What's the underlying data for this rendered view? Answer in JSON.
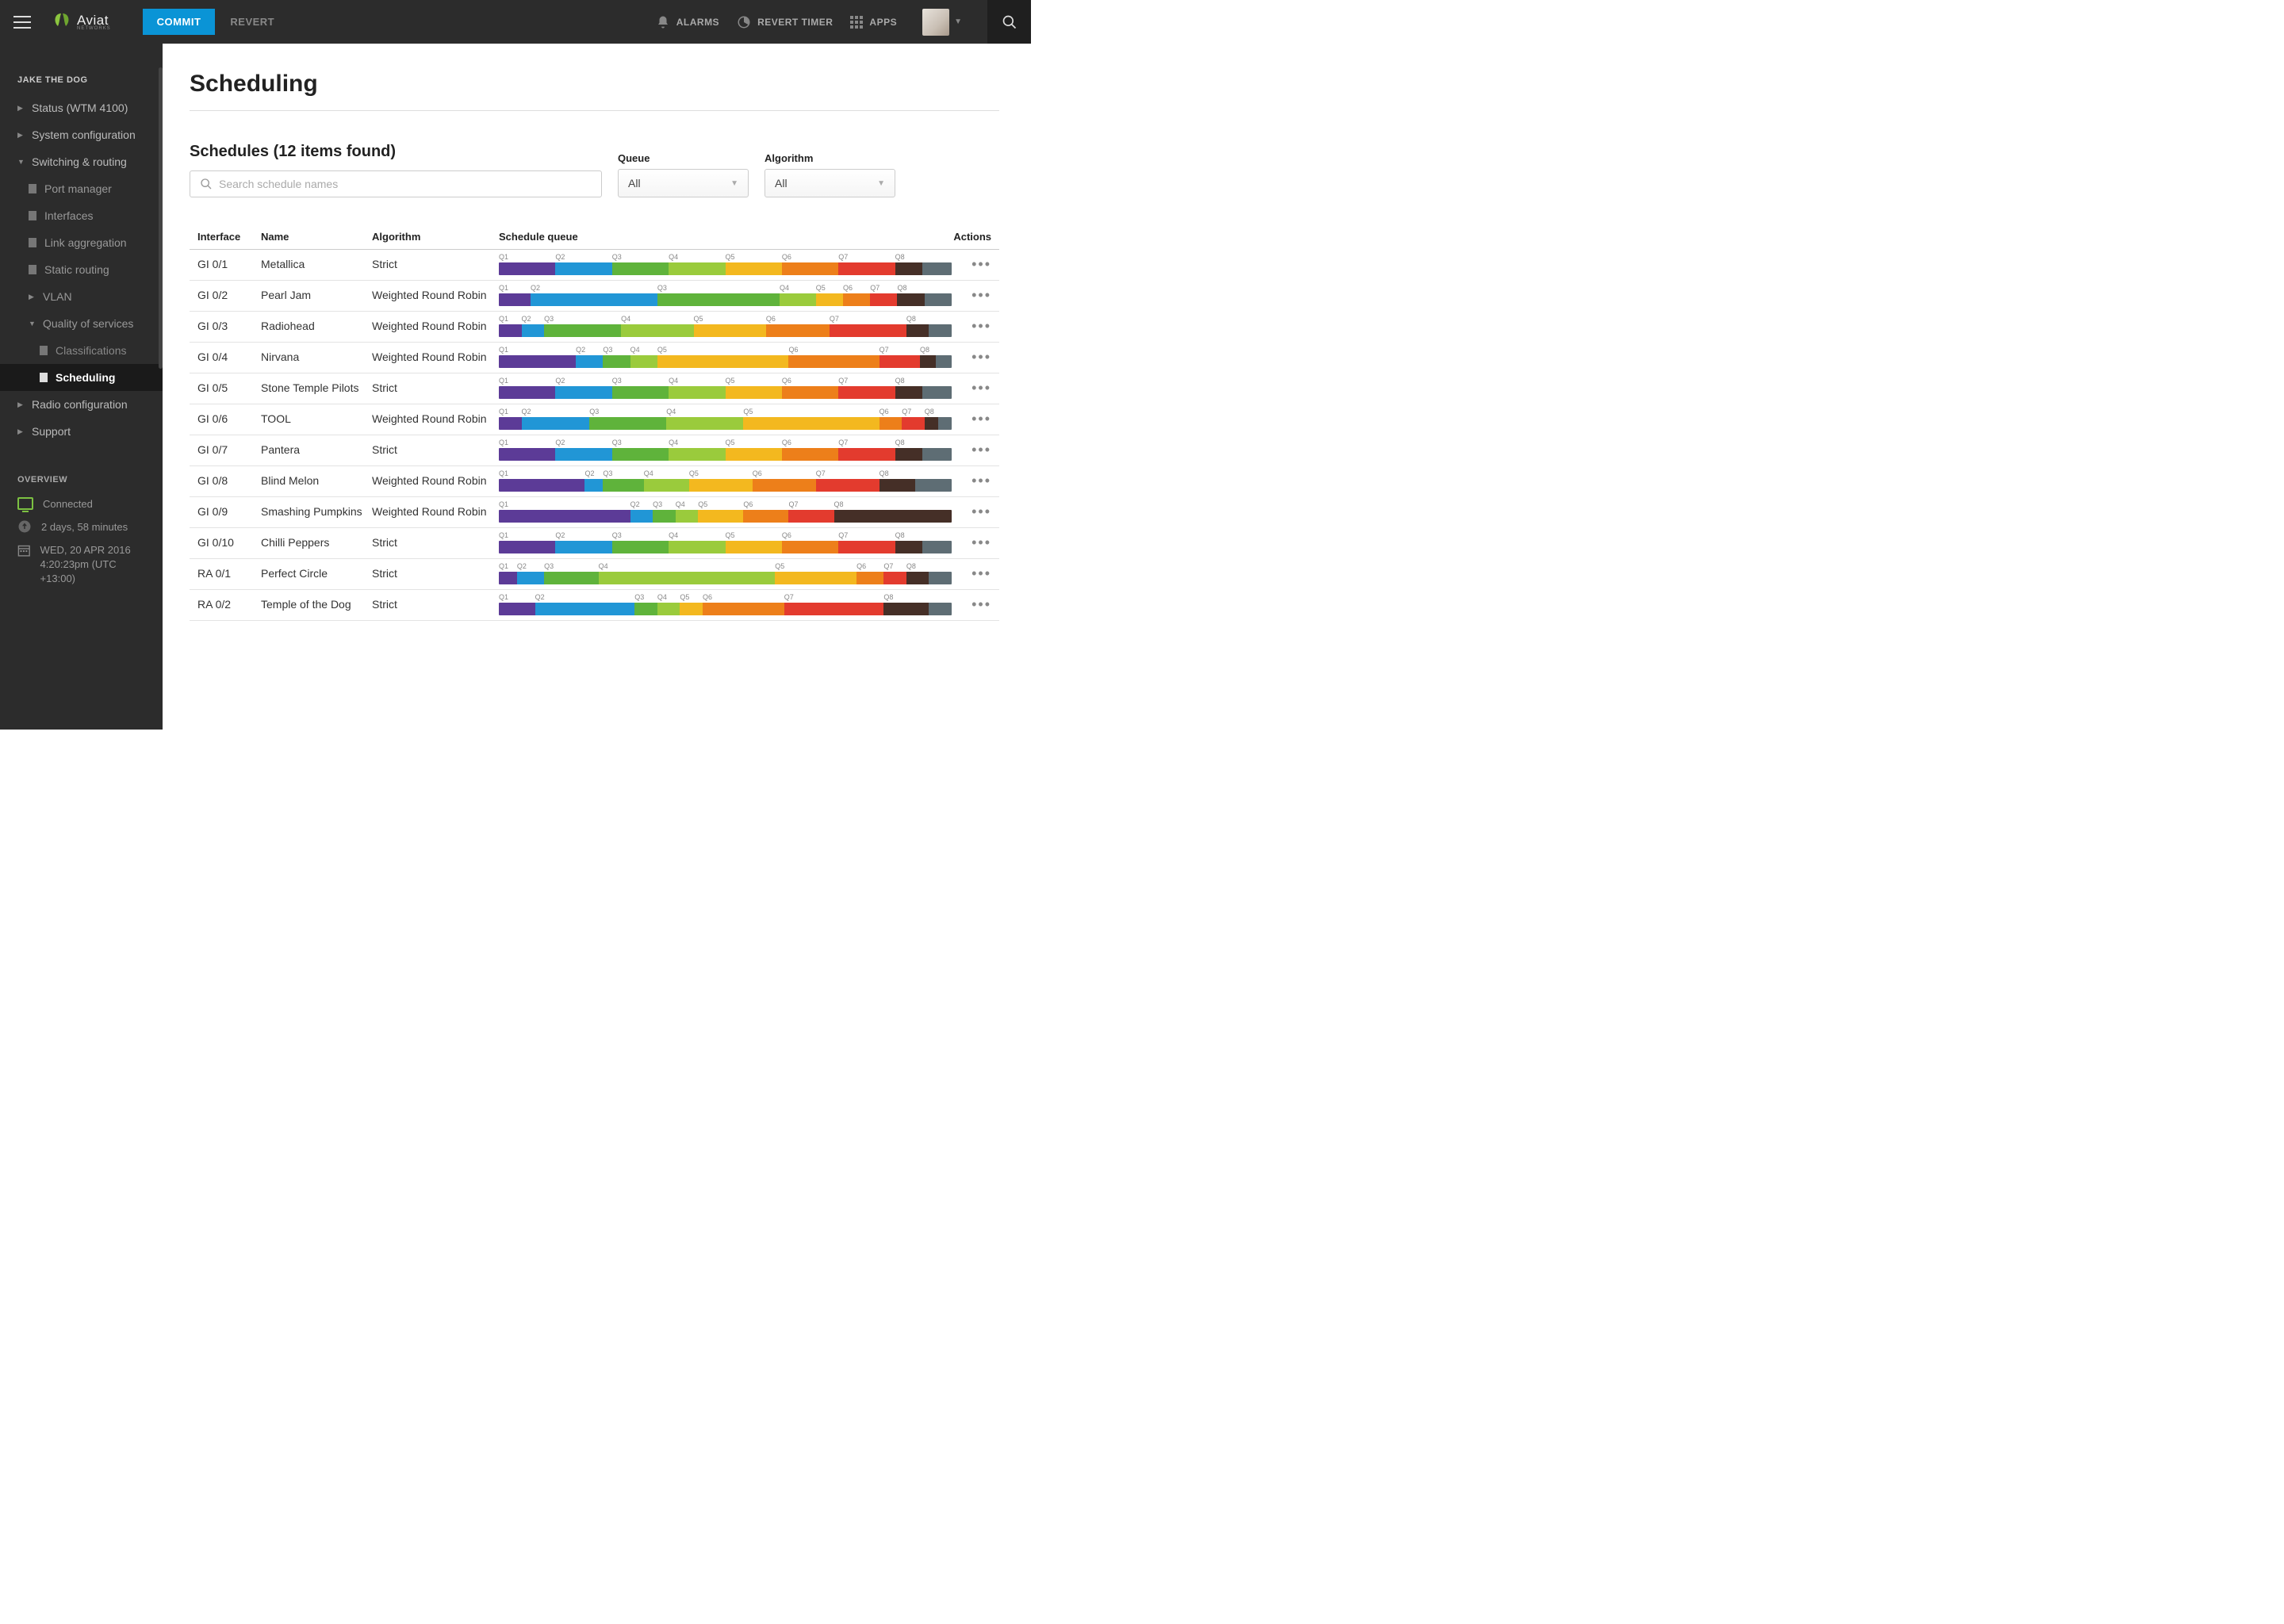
{
  "header": {
    "brand": "Aviat",
    "brand_sub": "NETWORKS",
    "commit": "COMMIT",
    "revert": "REVERT",
    "alarms": "ALARMS",
    "revert_timer": "REVERT TIMER",
    "apps": "APPS"
  },
  "sidebar": {
    "device_name": "JAKE THE DOG",
    "items": [
      {
        "label": "Status (WTM 4100)",
        "level": 1,
        "caret": "right"
      },
      {
        "label": "System configuration",
        "level": 1,
        "caret": "right"
      },
      {
        "label": "Switching & routing",
        "level": 1,
        "caret": "down"
      },
      {
        "label": "Port manager",
        "level": 2,
        "icon": "doc"
      },
      {
        "label": "Interfaces",
        "level": 2,
        "icon": "doc"
      },
      {
        "label": "Link aggregation",
        "level": 2,
        "icon": "doc"
      },
      {
        "label": "Static routing",
        "level": 2,
        "icon": "doc"
      },
      {
        "label": "VLAN",
        "level": 2,
        "caret": "right"
      },
      {
        "label": "Quality of services",
        "level": 2,
        "caret": "down"
      },
      {
        "label": "Classifications",
        "level": 3,
        "icon": "doc"
      },
      {
        "label": "Scheduling",
        "level": 3,
        "icon": "doc",
        "active": true
      },
      {
        "label": "Radio configuration",
        "level": 1,
        "caret": "right"
      },
      {
        "label": "Support",
        "level": 1,
        "caret": "right"
      }
    ],
    "overview_title": "OVERVIEW",
    "connection": "Connected",
    "uptime": "2 days, 58 minutes",
    "date_line1": "WED, 20 APR 2016",
    "date_line2": "4:20:23pm (UTC +13:00)"
  },
  "page": {
    "title": "Scheduling",
    "list_heading": "Schedules (12 items found)",
    "search_placeholder": "Search schedule names",
    "filter_queue_label": "Queue",
    "filter_algo_label": "Algorithm",
    "filter_all": "All"
  },
  "columns": {
    "interface": "Interface",
    "name": "Name",
    "algorithm": "Algorithm",
    "schedule_queue": "Schedule queue",
    "actions": "Actions"
  },
  "queue_labels": [
    "Q1",
    "Q2",
    "Q3",
    "Q4",
    "Q5",
    "Q6",
    "Q7",
    "Q8"
  ],
  "rows": [
    {
      "if": "GI 0/1",
      "name": "Metallica",
      "algo": "Strict",
      "segments": [
        [
          "q1",
          12.5
        ],
        [
          "q2",
          12.5
        ],
        [
          "q3",
          12.5
        ],
        [
          "q4",
          12.5
        ],
        [
          "q5",
          12.5
        ],
        [
          "q6",
          12.5
        ],
        [
          "q7",
          12.5
        ],
        [
          "q8",
          6
        ],
        [
          "q9",
          6.5
        ]
      ],
      "legend_pos": [
        0,
        12.5,
        25,
        37.5,
        50,
        62.5,
        75,
        87.5
      ]
    },
    {
      "if": "GI 0/2",
      "name": "Pearl Jam",
      "algo": "Weighted Round Robin",
      "segments": [
        [
          "q1",
          7
        ],
        [
          "q2",
          28
        ],
        [
          "q3",
          27
        ],
        [
          "q4",
          8
        ],
        [
          "q5",
          6
        ],
        [
          "q6",
          6
        ],
        [
          "q7",
          6
        ],
        [
          "q8",
          6
        ],
        [
          "q9",
          6
        ]
      ],
      "legend_pos": [
        0,
        7,
        35,
        62,
        70,
        76,
        82,
        88
      ]
    },
    {
      "if": "GI 0/3",
      "name": "Radiohead",
      "algo": "Weighted Round Robin",
      "segments": [
        [
          "q1",
          5
        ],
        [
          "q2",
          5
        ],
        [
          "q3",
          17
        ],
        [
          "q4",
          16
        ],
        [
          "q5",
          16
        ],
        [
          "q6",
          14
        ],
        [
          "q7",
          17
        ],
        [
          "q8",
          5
        ],
        [
          "q9",
          5
        ]
      ],
      "legend_pos": [
        0,
        5,
        10,
        27,
        43,
        59,
        73,
        90
      ]
    },
    {
      "if": "GI 0/4",
      "name": "Nirvana",
      "algo": "Weighted Round Robin",
      "segments": [
        [
          "q1",
          17
        ],
        [
          "q2",
          6
        ],
        [
          "q3",
          6
        ],
        [
          "q4",
          6
        ],
        [
          "q5",
          29
        ],
        [
          "q6",
          20
        ],
        [
          "q7",
          9
        ],
        [
          "q8",
          3.5
        ],
        [
          "q9",
          3.5
        ]
      ],
      "legend_pos": [
        0,
        17,
        23,
        29,
        35,
        64,
        84,
        93
      ]
    },
    {
      "if": "GI 0/5",
      "name": "Stone Temple Pilots",
      "algo": "Strict",
      "segments": [
        [
          "q1",
          12.5
        ],
        [
          "q2",
          12.5
        ],
        [
          "q3",
          12.5
        ],
        [
          "q4",
          12.5
        ],
        [
          "q5",
          12.5
        ],
        [
          "q6",
          12.5
        ],
        [
          "q7",
          12.5
        ],
        [
          "q8",
          6
        ],
        [
          "q9",
          6.5
        ]
      ],
      "legend_pos": [
        0,
        12.5,
        25,
        37.5,
        50,
        62.5,
        75,
        87.5
      ]
    },
    {
      "if": "GI 0/6",
      "name": "TOOL",
      "algo": "Weighted Round Robin",
      "segments": [
        [
          "q1",
          5
        ],
        [
          "q2",
          15
        ],
        [
          "q3",
          17
        ],
        [
          "q4",
          17
        ],
        [
          "q5",
          30
        ],
        [
          "q6",
          5
        ],
        [
          "q7",
          5
        ],
        [
          "q8",
          3
        ],
        [
          "q9",
          3
        ]
      ],
      "legend_pos": [
        0,
        5,
        20,
        37,
        54,
        84,
        89,
        94
      ]
    },
    {
      "if": "GI 0/7",
      "name": "Pantera",
      "algo": "Strict",
      "segments": [
        [
          "q1",
          12.5
        ],
        [
          "q2",
          12.5
        ],
        [
          "q3",
          12.5
        ],
        [
          "q4",
          12.5
        ],
        [
          "q5",
          12.5
        ],
        [
          "q6",
          12.5
        ],
        [
          "q7",
          12.5
        ],
        [
          "q8",
          6
        ],
        [
          "q9",
          6.5
        ]
      ],
      "legend_pos": [
        0,
        12.5,
        25,
        37.5,
        50,
        62.5,
        75,
        87.5
      ]
    },
    {
      "if": "GI 0/8",
      "name": "Blind Melon",
      "algo": "Weighted Round Robin",
      "segments": [
        [
          "q1",
          19
        ],
        [
          "q2",
          4
        ],
        [
          "q3",
          9
        ],
        [
          "q4",
          10
        ],
        [
          "q5",
          14
        ],
        [
          "q6",
          14
        ],
        [
          "q7",
          14
        ],
        [
          "q8",
          8
        ],
        [
          "q9",
          8
        ]
      ],
      "legend_pos": [
        0,
        19,
        23,
        32,
        42,
        56,
        70,
        84
      ]
    },
    {
      "if": "GI 0/9",
      "name": "Smashing Pumpkins",
      "algo": "Weighted Round Robin",
      "segments": [
        [
          "q1",
          29
        ],
        [
          "q2",
          5
        ],
        [
          "q3",
          5
        ],
        [
          "q4",
          5
        ],
        [
          "q5",
          10
        ],
        [
          "q6",
          10
        ],
        [
          "q7",
          10
        ],
        [
          "q8",
          26
        ]
      ],
      "legend_pos": [
        0,
        29,
        34,
        39,
        44,
        54,
        64,
        74
      ]
    },
    {
      "if": "GI 0/10",
      "name": "Chilli Peppers",
      "algo": "Strict",
      "segments": [
        [
          "q1",
          12.5
        ],
        [
          "q2",
          12.5
        ],
        [
          "q3",
          12.5
        ],
        [
          "q4",
          12.5
        ],
        [
          "q5",
          12.5
        ],
        [
          "q6",
          12.5
        ],
        [
          "q7",
          12.5
        ],
        [
          "q8",
          6
        ],
        [
          "q9",
          6.5
        ]
      ],
      "legend_pos": [
        0,
        12.5,
        25,
        37.5,
        50,
        62.5,
        75,
        87.5
      ]
    },
    {
      "if": "RA 0/1",
      "name": "Perfect Circle",
      "algo": "Strict",
      "segments": [
        [
          "q1",
          4
        ],
        [
          "q2",
          6
        ],
        [
          "q3",
          12
        ],
        [
          "q4",
          39
        ],
        [
          "q5",
          18
        ],
        [
          "q6",
          6
        ],
        [
          "q7",
          5
        ],
        [
          "q8",
          5
        ],
        [
          "q9",
          5
        ]
      ],
      "legend_pos": [
        0,
        4,
        10,
        22,
        61,
        79,
        85,
        90
      ]
    },
    {
      "if": "RA 0/2",
      "name": "Temple of the Dog",
      "algo": "Strict",
      "segments": [
        [
          "q1",
          8
        ],
        [
          "q2",
          22
        ],
        [
          "q3",
          5
        ],
        [
          "q4",
          5
        ],
        [
          "q5",
          5
        ],
        [
          "q6",
          18
        ],
        [
          "q7",
          22
        ],
        [
          "q8",
          10
        ],
        [
          "q9",
          5
        ]
      ],
      "legend_pos": [
        0,
        8,
        30,
        35,
        40,
        45,
        63,
        85
      ]
    }
  ]
}
